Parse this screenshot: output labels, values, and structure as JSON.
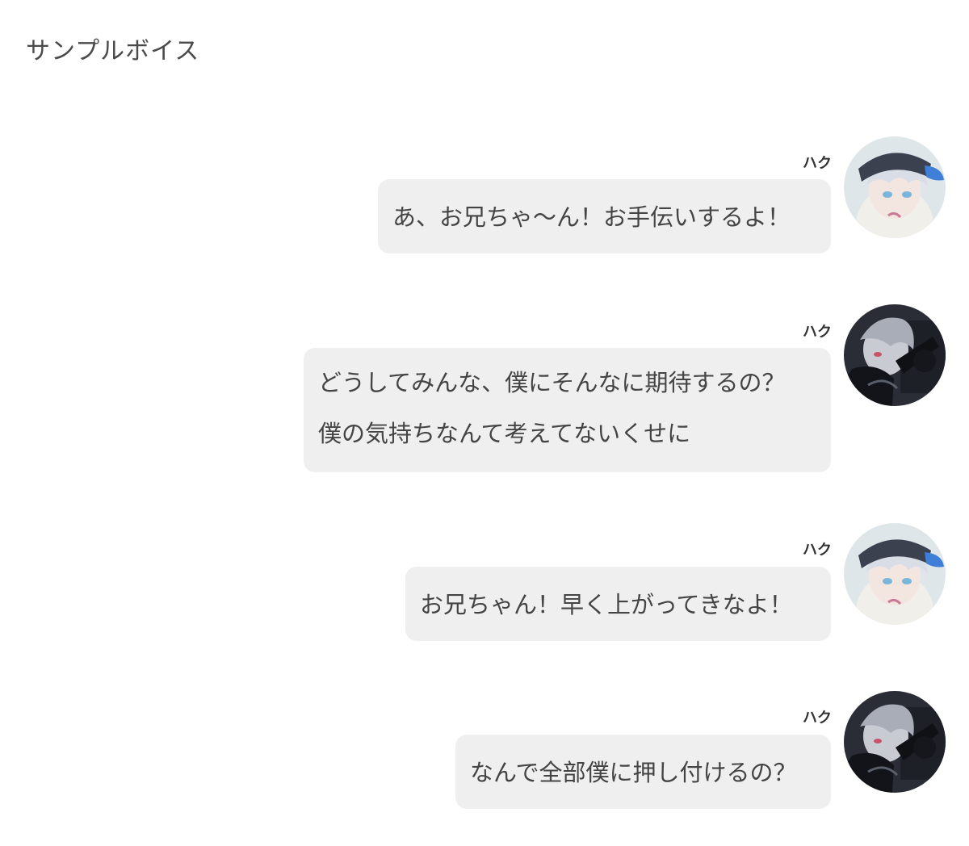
{
  "page": {
    "title": "サンプルボイス"
  },
  "voices": [
    {
      "speaker": "ハク",
      "lines": [
        "あ、お兄ちゃ〜ん！お手伝いするよ！"
      ],
      "avatar_style": "light"
    },
    {
      "speaker": "ハク",
      "lines": [
        "どうしてみんな、僕にそんなに期待するの？",
        "僕の気持ちなんて考えてないくせに"
      ],
      "avatar_style": "dark"
    },
    {
      "speaker": "ハク",
      "lines": [
        "お兄ちゃん！早く上がってきなよ！"
      ],
      "avatar_style": "light"
    },
    {
      "speaker": "ハク",
      "lines": [
        "なんで全部僕に押し付けるの？"
      ],
      "avatar_style": "dark"
    }
  ],
  "colors": {
    "bubble_bg": "#efefef",
    "text": "#444444",
    "accent_cap_blue": "#3f7fd8"
  }
}
